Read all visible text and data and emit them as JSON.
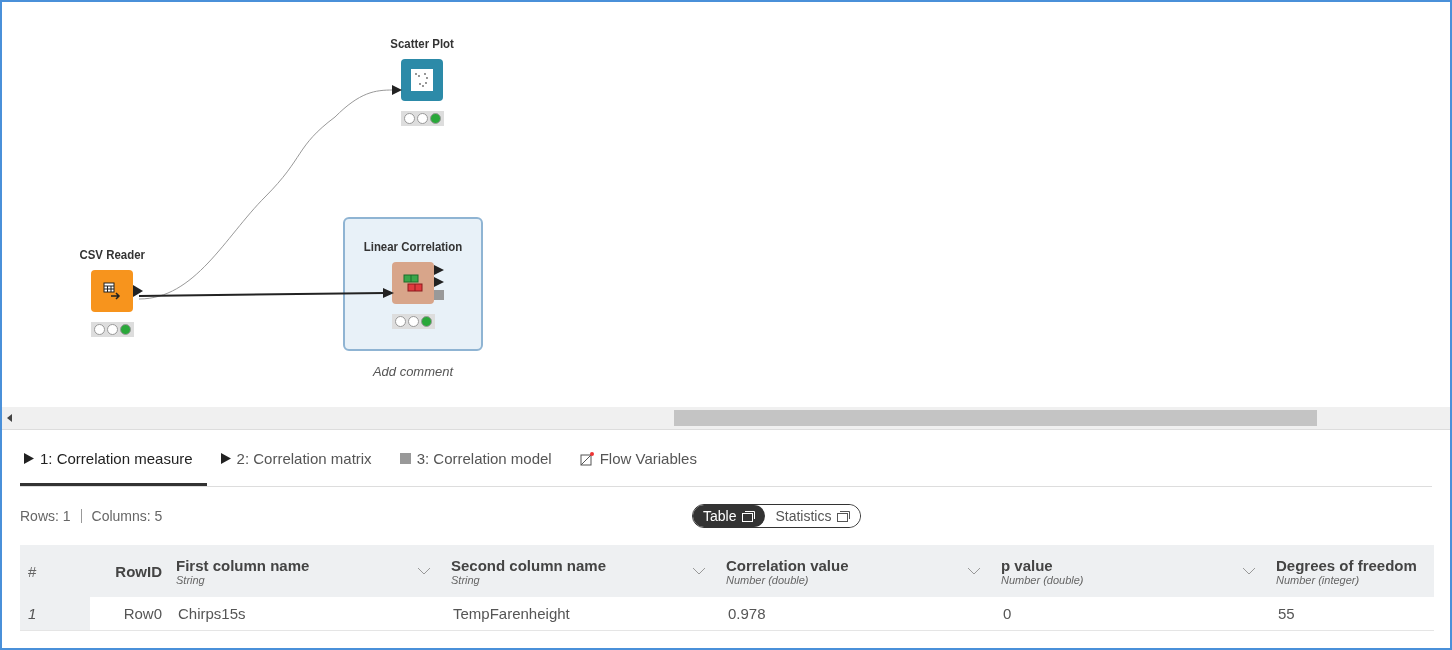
{
  "workflow": {
    "nodes": [
      {
        "label": "Scatter Plot",
        "kind": "view",
        "selected": false,
        "lights": [
          {
            "lit": false
          },
          {
            "lit": false
          },
          {
            "lit": true
          }
        ]
      },
      {
        "label": "CSV Reader",
        "kind": "source",
        "selected": false,
        "lights": [
          {
            "lit": false
          },
          {
            "lit": false
          },
          {
            "lit": true
          }
        ]
      },
      {
        "label": "Linear Correlation",
        "kind": "manipulator",
        "selected": true,
        "lights": [
          {
            "lit": false
          },
          {
            "lit": false
          },
          {
            "lit": true
          }
        ],
        "comment": "Add comment"
      }
    ]
  },
  "output": {
    "tabs": [
      {
        "label": "1: Correlation measure",
        "kind": "data",
        "selected": true
      },
      {
        "label": "2: Correlation matrix",
        "kind": "data",
        "selected": false
      },
      {
        "label": "3: Correlation model",
        "kind": "model",
        "selected": false
      },
      {
        "label": "Flow Variables",
        "kind": "flow",
        "selected": false
      }
    ],
    "rows_count": "Rows: 1",
    "columns_count": "Columns: 5",
    "views": [
      {
        "label": "Table",
        "selected": true
      },
      {
        "label": "Statistics",
        "selected": false
      }
    ],
    "table": {
      "index_header": "#",
      "rowid_header": "RowID",
      "columns": [
        {
          "name": "First column name",
          "type": "String"
        },
        {
          "name": "Second column name",
          "type": "String"
        },
        {
          "name": "Correlation value",
          "type": "Number (double)"
        },
        {
          "name": "p value",
          "type": "Number (double)"
        },
        {
          "name": "Degrees of freedom",
          "type": "Number (integer)"
        }
      ],
      "rows": [
        {
          "index": "1",
          "rowid": "Row0",
          "cells": [
            "Chirps15s",
            "TempFarenheight",
            "0.978",
            "0",
            "55"
          ]
        }
      ]
    }
  }
}
